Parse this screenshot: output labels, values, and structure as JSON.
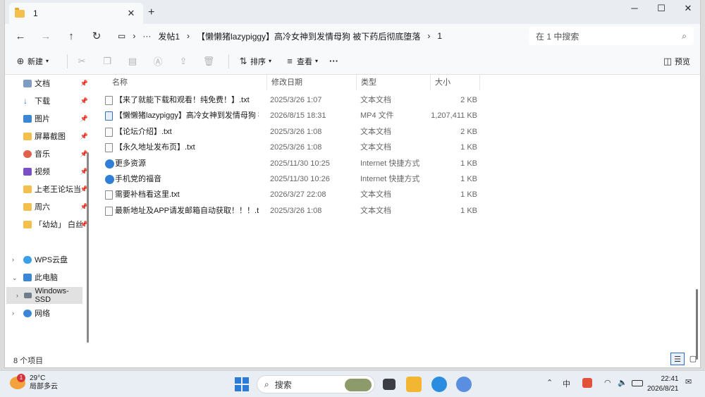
{
  "tab": {
    "title": "1"
  },
  "address": {
    "segments": [
      "›",
      "···",
      "发帖1",
      "›",
      "【懒懒猪lazypiggy】高冷女神到发情母狗 被下药后彻底堕落",
      "›",
      "1"
    ],
    "search_placeholder": "在 1 中搜索"
  },
  "toolbar": {
    "new_label": "新建",
    "sort_label": "排序",
    "view_label": "查看",
    "more_label": "···",
    "preview_label": "预览"
  },
  "sidebar": {
    "quick_items": [
      {
        "label": "文档",
        "icon": "document-icon"
      },
      {
        "label": "下载",
        "icon": "download-icon"
      },
      {
        "label": "图片",
        "icon": "picture-icon"
      },
      {
        "label": "屏幕截图",
        "icon": "folder-icon"
      },
      {
        "label": "音乐",
        "icon": "music-icon"
      },
      {
        "label": "视频",
        "icon": "video-icon"
      },
      {
        "label": "上老王论坛当",
        "icon": "folder-icon"
      },
      {
        "label": "周六",
        "icon": "folder-icon"
      },
      {
        "label": "「幼幼」 白丝",
        "icon": "folder-icon"
      }
    ],
    "tree_items": [
      {
        "label": "WPS云盘",
        "icon": "cloud-icon"
      },
      {
        "label": "此电脑",
        "icon": "computer-icon"
      },
      {
        "label": "Windows-SSD",
        "icon": "drive-icon"
      },
      {
        "label": "网络",
        "icon": "network-icon"
      }
    ]
  },
  "columns": {
    "name": "名称",
    "date": "修改日期",
    "type": "类型",
    "size": "大小"
  },
  "files": [
    {
      "name": "【来了就能下载和观看！纯免费！】.txt",
      "date": "2025/3/26 1:07",
      "type": "文本文档",
      "size": "2 KB",
      "icon": "text-file-icon"
    },
    {
      "name": "【懒懒猪lazypiggy】高冷女神到发情母狗 被下...",
      "date": "2026/8/15 18:31",
      "type": "MP4 文件",
      "size": "1,207,411 KB",
      "icon": "video-file-icon"
    },
    {
      "name": "【论坛介绍】.txt",
      "date": "2025/3/26 1:08",
      "type": "文本文档",
      "size": "2 KB",
      "icon": "text-file-icon"
    },
    {
      "name": "【永久地址发布页】.txt",
      "date": "2025/3/26 1:08",
      "type": "文本文档",
      "size": "1 KB",
      "icon": "text-file-icon"
    },
    {
      "name": "更多资源",
      "date": "2025/11/30 10:25",
      "type": "Internet 快捷方式",
      "size": "1 KB",
      "icon": "internet-shortcut-icon"
    },
    {
      "name": "手机党的福音",
      "date": "2025/11/30 10:26",
      "type": "Internet 快捷方式",
      "size": "1 KB",
      "icon": "internet-shortcut-icon"
    },
    {
      "name": "需要补档看这里.txt",
      "date": "2026/3/27 22:08",
      "type": "文本文档",
      "size": "1 KB",
      "icon": "text-file-icon"
    },
    {
      "name": "最新地址及APP请发邮箱自动获取！！！.txt",
      "date": "2025/3/26 1:08",
      "type": "文本文档",
      "size": "1 KB",
      "icon": "text-file-icon"
    }
  ],
  "status": {
    "count": "8 个项目"
  },
  "taskbar": {
    "weather_temp": "29°C",
    "weather_desc": "局部多云",
    "weather_badge": "1",
    "search_label": "搜索",
    "ime": "中",
    "time": "22:41",
    "date": "2026/8/21"
  }
}
